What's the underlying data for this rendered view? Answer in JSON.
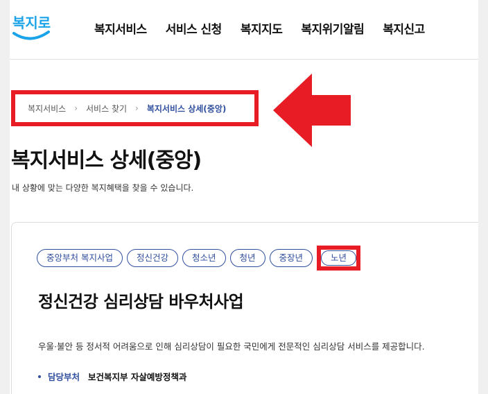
{
  "logo": {
    "text": "복지로"
  },
  "nav": {
    "items": [
      "복지서비스",
      "서비스 신청",
      "복지지도",
      "복지위기알림",
      "복지신고"
    ]
  },
  "breadcrumb": {
    "items": [
      "복지서비스",
      "서비스 찾기",
      "복지서비스 상세(중앙)"
    ]
  },
  "page": {
    "title": "복지서비스 상세(중앙)",
    "description": "내 상황에 맞는 다양한 복지혜택을 찾을 수 있습니다."
  },
  "service": {
    "tags": [
      "중앙부처 복지사업",
      "정신건강",
      "청소년",
      "청년",
      "중장년",
      "노년"
    ],
    "title": "정신건강 심리상담 바우처사업",
    "description": "우울·불안 등 정서적 어려움으로 인해 심리상담이 필요한 국민에게 전문적인 심리상담 서비스를 제공합니다.",
    "dept_label": "담당부처",
    "dept_value": "보건복지부 자살예방정책과"
  },
  "colors": {
    "accent": "#2f4e9e",
    "highlight": "#e81c24",
    "logo_blue": "#1aa3e8"
  }
}
